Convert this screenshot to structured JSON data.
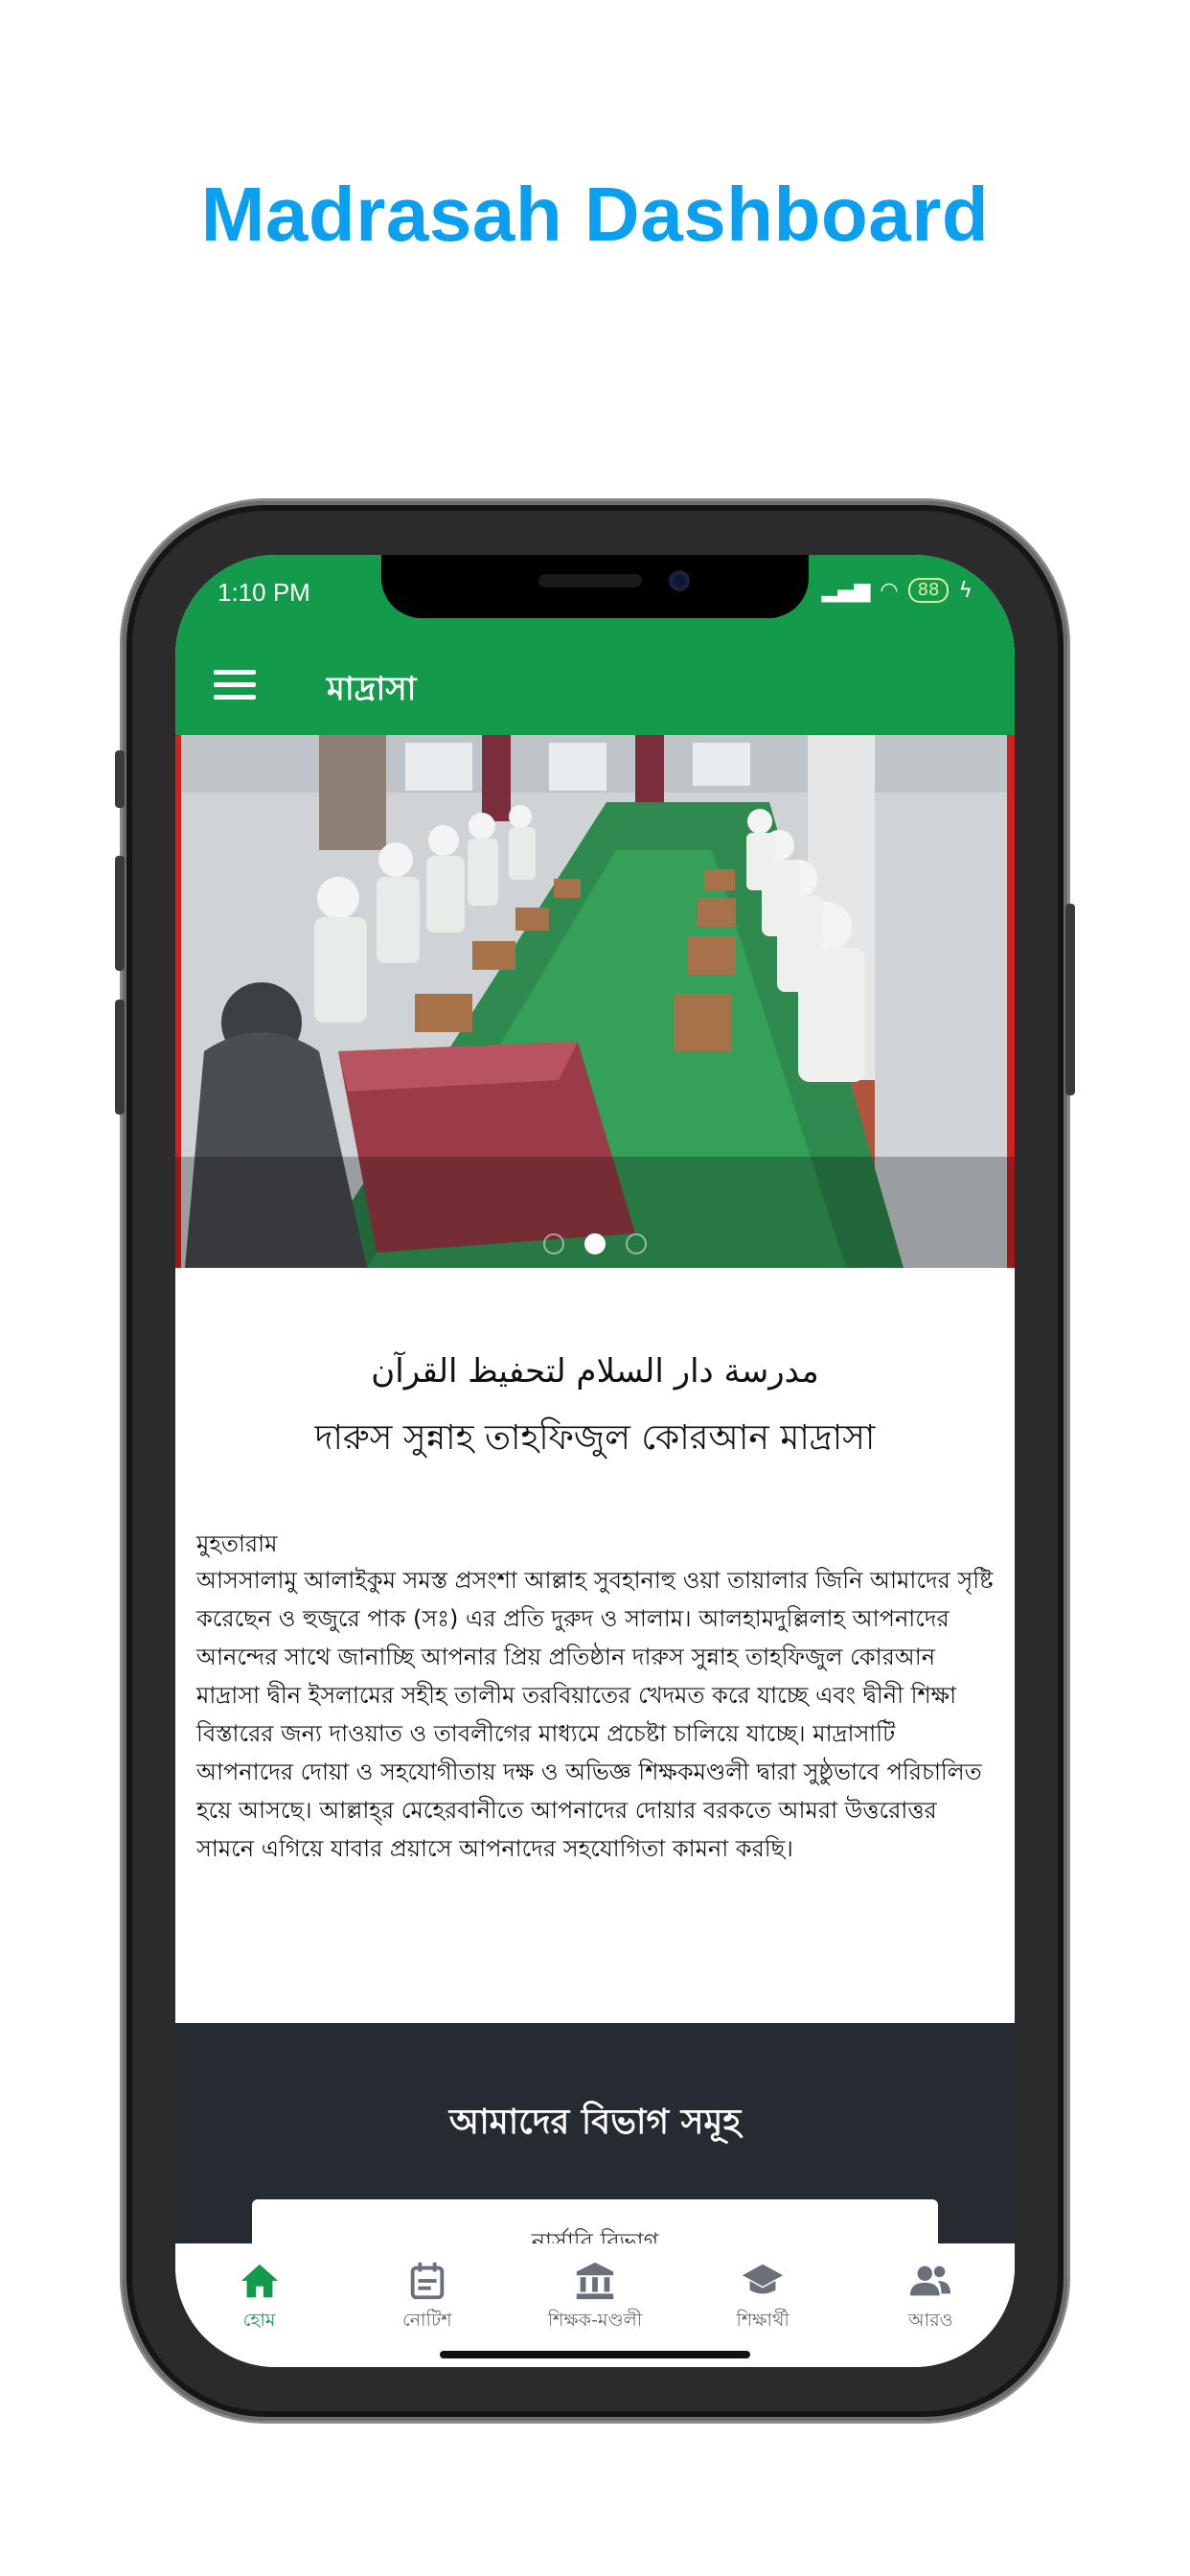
{
  "headline": "Madrasah Dashboard",
  "status_bar": {
    "time": "1:10 PM",
    "battery": "88"
  },
  "appbar": {
    "title": "মাদ্রাসা"
  },
  "carousel": {
    "slide_count": 3,
    "active_index": 1
  },
  "content": {
    "arabic_title": "مدرسة دار السلام لتحفيظ القرآن",
    "bengali_title": "দারুস সুন্নাহ তাহফিজুল কোরআন মাদ্রাসা",
    "salutation": "মুহতারাম",
    "intro": "আসসালামু আলাইকুম সমস্ত প্রসংশা আল্লাহ সুবহানাহু ওয়া তায়ালার জিনি আমাদের সৃষ্টি করেছেন ও হুজুরে পাক (সঃ) এর প্রতি দুরুদ ও সালাম। আলহামদুল্লিলাহ আপনাদের আনন্দের সাথে জানাচ্ছি আপনার প্রিয় প্রতিষ্ঠান দারুস সুন্নাহ তাহফিজুল কোরআন মাদ্রাসা দ্বীন ইসলামের সহীহ তালীম তরবিয়াতের খেদমত করে যাচ্ছে এবং দ্বীনী শিক্ষা বিস্তারের জন্য দাওয়াত ও তাবলীগের মাধ্যমে প্রচেষ্টা চালিয়ে যাচ্ছে। মাদ্রাসাটি আপনাদের দোয়া ও সহযোগীতায় দক্ষ ও অভিজ্ঞ শিক্ষকমণ্ডলী দ্বারা সুষ্ঠুভাবে পরিচালিত হয়ে আসছে। আল্লাহ্‌র মেহেরবানীতে আপনাদের দোয়ার বরকতে আমরা উত্তরোত্তর সামনে এগিয়ে যাবার প্রয়াসে আপনাদের সহযোগিতা কামনা করছি।"
  },
  "departments": {
    "title": "আমাদের বিভাগ সমূহ",
    "first_card": "নার্সারি বিভাগ"
  },
  "bottom_nav": [
    {
      "label": "হোম",
      "icon": "home-icon",
      "active": true
    },
    {
      "label": "নোটিশ",
      "icon": "notice-icon",
      "active": false
    },
    {
      "label": "শিক্ষক-মণ্ডলী",
      "icon": "institution-icon",
      "active": false
    },
    {
      "label": "শিক্ষার্থী",
      "icon": "graduation-cap-icon",
      "active": false
    },
    {
      "label": "আরও",
      "icon": "people-icon",
      "active": false
    }
  ],
  "colors": {
    "headline": "#0aa0ef",
    "appbar": "#149a4b",
    "dept_bg": "#262a31",
    "nav_inactive": "#6a6f7a"
  }
}
